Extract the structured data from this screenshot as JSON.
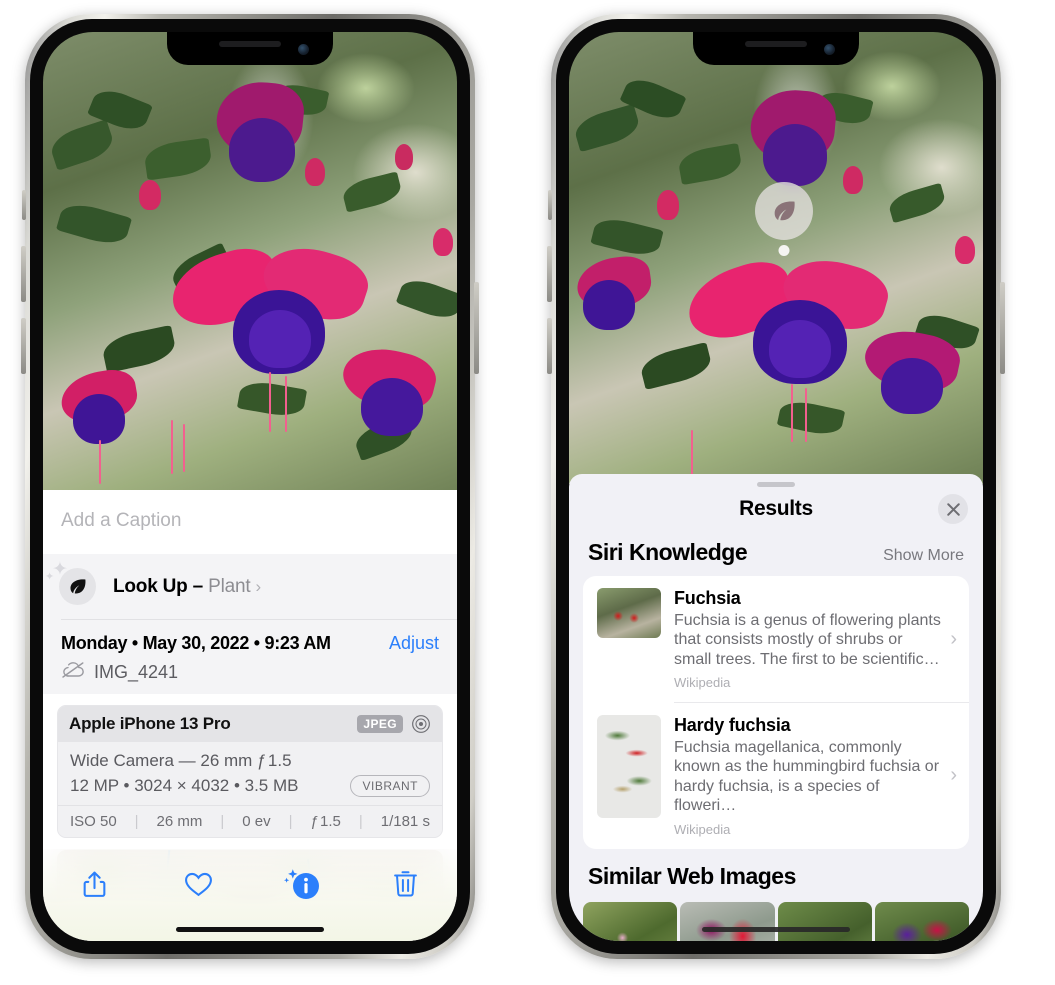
{
  "left_phone": {
    "caption_placeholder": "Add a Caption",
    "lookup": {
      "label": "Look Up",
      "dash": " – ",
      "subject": "Plant",
      "chevron": "›",
      "icon": "leaf-icon"
    },
    "meta": {
      "date_line": "Monday • May 30, 2022 • 9:23 AM",
      "adjust_label": "Adjust",
      "filename": "IMG_4241",
      "cloud_icon": "icloud-slash-icon"
    },
    "camera": {
      "device": "Apple iPhone 13 Pro",
      "format_badge": "JPEG",
      "aperture_icon": "aperture-icon",
      "lens_line": "Wide Camera — 26 mm ƒ 1.5",
      "specs_line": "12 MP • 3024 × 4032 • 3.5 MB",
      "style_badge": "VIBRANT",
      "exif": [
        "ISO 50",
        "26 mm",
        "0 ev",
        "ƒ 1.5",
        "1/181 s"
      ],
      "exif_separator": "|"
    },
    "toolbar": [
      {
        "name": "share-button",
        "icon": "share-icon",
        "active": false
      },
      {
        "name": "favorite-button",
        "icon": "heart-icon",
        "active": false
      },
      {
        "name": "info-button",
        "icon": "info-sparkle-icon",
        "active": true
      },
      {
        "name": "delete-button",
        "icon": "trash-icon",
        "active": false
      }
    ],
    "accent_color": "#2b7ffb"
  },
  "right_phone": {
    "photo_badge": {
      "icon": "leaf-icon",
      "name": "visual-lookup-badge"
    },
    "sheet": {
      "title": "Results",
      "close_icon": "close-icon",
      "sections": [
        {
          "title": "Siri Knowledge",
          "action_label": "Show More",
          "items": [
            {
              "title": "Fuchsia",
              "description": "Fuchsia is a genus of flowering plants that consists mostly of shrubs or small trees. The first to be scientific…",
              "source": "Wikipedia",
              "chevron": "›"
            },
            {
              "title": "Hardy fuchsia",
              "description": "Fuchsia magellanica, commonly known as the hummingbird fuchsia or hardy fuchsia, is a species of floweri…",
              "source": "Wikipedia",
              "chevron": "›"
            }
          ]
        },
        {
          "title": "Similar Web Images",
          "image_count": 4
        }
      ]
    }
  }
}
